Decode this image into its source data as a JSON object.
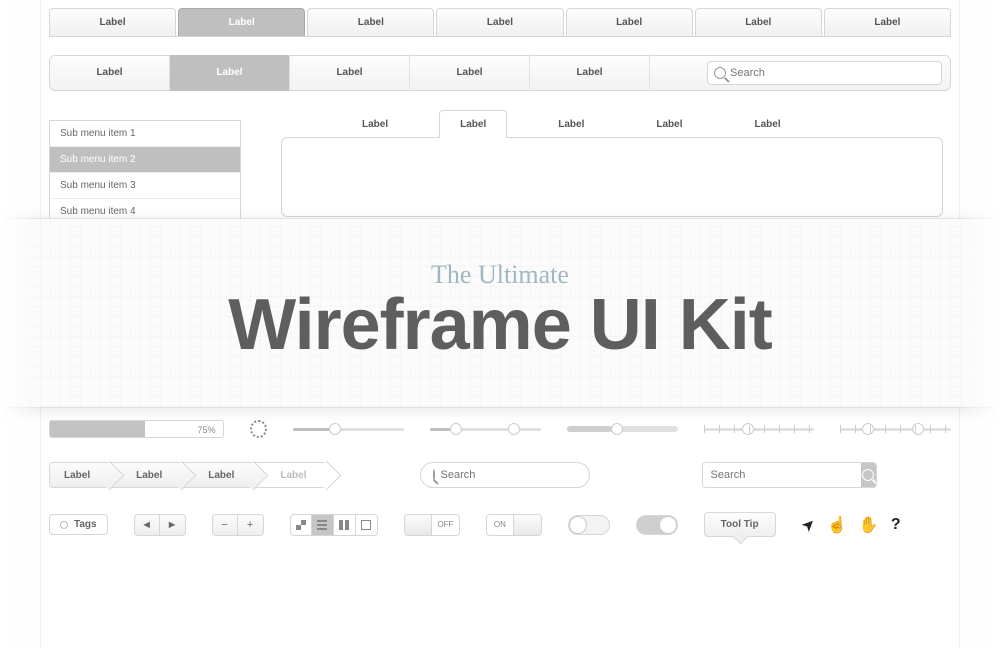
{
  "tabs1": [
    "Label",
    "Label",
    "Label",
    "Label",
    "Label",
    "Label",
    "Label"
  ],
  "tabs1_active": 1,
  "nav2": {
    "items": [
      "Label",
      "Label",
      "Label",
      "Label",
      "Label"
    ],
    "active": 1,
    "search_placeholder": "Search"
  },
  "submenu": {
    "items": [
      "Sub menu item 1",
      "Sub menu item 2",
      "Sub menu item 3",
      "Sub menu item 4"
    ],
    "active": 1
  },
  "inner_tabs": {
    "items": [
      "Label",
      "Label",
      "Label",
      "Label",
      "Label"
    ],
    "active": 1
  },
  "hero": {
    "pre": "The Ultimate",
    "title": "Wireframe UI Kit"
  },
  "progress": {
    "pct": "75%"
  },
  "breadcrumb": [
    "Label",
    "Label",
    "Label",
    "Label"
  ],
  "search2": {
    "placeholder": "Search"
  },
  "search3": {
    "placeholder": "Search"
  },
  "tags_label": "Tags",
  "switch_off": "OFF",
  "switch_on": "ON",
  "tooltip": "Tool Tip",
  "cursors": {
    "pointer": "➤",
    "hand": "☝",
    "grab": "✋",
    "help": "?"
  }
}
